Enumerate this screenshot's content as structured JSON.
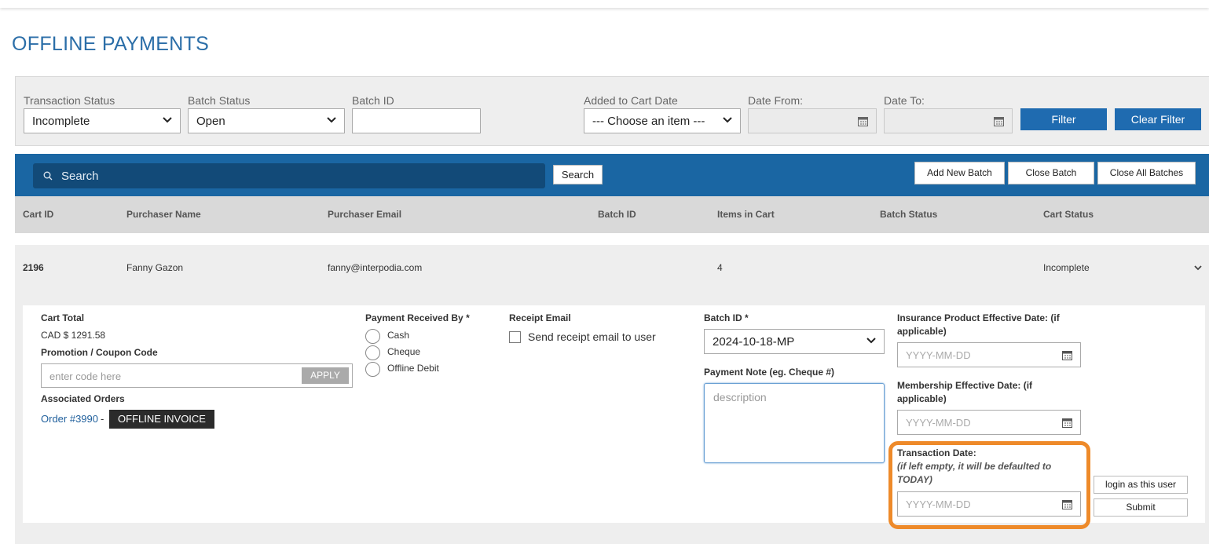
{
  "page": {
    "title": "OFFLINE PAYMENTS"
  },
  "filters": {
    "transaction_status": {
      "label": "Transaction Status",
      "value": "Incomplete"
    },
    "batch_status": {
      "label": "Batch Status",
      "value": "Open"
    },
    "batch_id": {
      "label": "Batch ID",
      "value": ""
    },
    "added_to_cart_date": {
      "label": "Added to Cart Date",
      "value": "--- Choose an item ---"
    },
    "date_from": {
      "label": "Date From:",
      "value": ""
    },
    "date_to": {
      "label": "Date To:",
      "value": ""
    },
    "filter_label": "Filter",
    "clear_filter_label": "Clear Filter"
  },
  "toolbar": {
    "search_placeholder": "Search",
    "search_button": "Search",
    "add_new_batch": "Add New Batch",
    "close_batch": "Close Batch",
    "close_all_batches": "Close All Batches"
  },
  "table": {
    "headers": [
      "Cart ID",
      "Purchaser Name",
      "Purchaser Email",
      "Batch ID",
      "Items in Cart",
      "Batch Status",
      "Cart Status"
    ],
    "row": {
      "cart_id": "2196",
      "purchaser_name": "Fanny Gazon",
      "purchaser_email": "fanny@interpodia.com",
      "batch_id": "",
      "items_in_cart": "4",
      "batch_status": "",
      "cart_status": "Incomplete"
    }
  },
  "detail": {
    "cart_total_label": "Cart Total",
    "cart_total_value": "CAD $ 1291.58",
    "promo_label": "Promotion / Coupon Code",
    "promo_placeholder": "enter code here",
    "apply_label": "APPLY",
    "associated_orders_label": "Associated Orders",
    "order_link": "Order #3990",
    "order_separator": "-",
    "offline_invoice": "OFFLINE INVOICE",
    "payment_received_by_label": "Payment Received By *",
    "payment_options": [
      "Cash",
      "Cheque",
      "Offline Debit"
    ],
    "receipt_email_label": "Receipt Email",
    "send_receipt_label": "Send receipt email to user",
    "batch_id_label": "Batch ID *",
    "batch_id_value": "2024-10-18-MP",
    "payment_note_label": "Payment Note (eg. Cheque #)",
    "payment_note_placeholder": "description",
    "insurance_label_1": "Insurance Product Effective Date: (if",
    "insurance_label_2": "applicable)",
    "membership_label_1": "Membership Effective Date: (if",
    "membership_label_2": "applicable)",
    "transaction_date_label": "Transaction Date:",
    "transaction_note_1": "(if left empty, it will be defaulted to",
    "transaction_note_2": "TODAY)",
    "date_placeholder": "YYYY-MM-DD",
    "login_as_user": "login as this user",
    "submit": "Submit"
  },
  "colors": {
    "accent": "#1f6bb0",
    "highlight": "#ee8a2a",
    "title": "#2b6ea8"
  }
}
